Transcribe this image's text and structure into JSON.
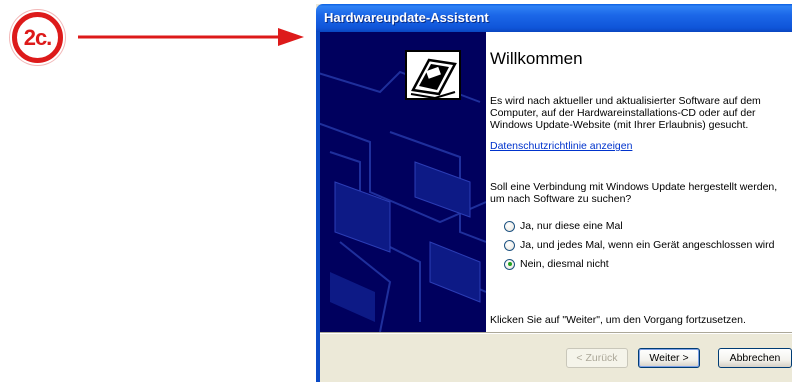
{
  "annotation": {
    "step_label": "2c.",
    "accent_color": "#dd1a1a"
  },
  "window": {
    "title": "Hardwareupdate-Assistent",
    "icon": "hardware-install-icon"
  },
  "content": {
    "heading": "Willkommen",
    "intro": "Es wird nach aktueller und aktualisierter Software auf dem\nComputer, auf der Hardwareinstallations-CD oder auf der\nWindows Update-Website (mit Ihrer Erlaubnis) gesucht.",
    "privacy_link": "Datenschutzrichtlinie anzeigen",
    "question": "Soll eine Verbindung mit Windows Update hergestellt werden,\num nach Software zu suchen?",
    "options": [
      {
        "label": "Ja, nur diese eine Mal",
        "selected": false
      },
      {
        "label": "Ja, und jedes Mal, wenn ein Gerät angeschlossen wird",
        "selected": false
      },
      {
        "label": "Nein, diesmal nicht",
        "selected": true
      }
    ],
    "continue_hint": "Klicken Sie auf \"Weiter\", um den Vorgang fortzusetzen."
  },
  "buttons": {
    "back": "< Zurück",
    "next": "Weiter >",
    "cancel": "Abbrechen"
  }
}
